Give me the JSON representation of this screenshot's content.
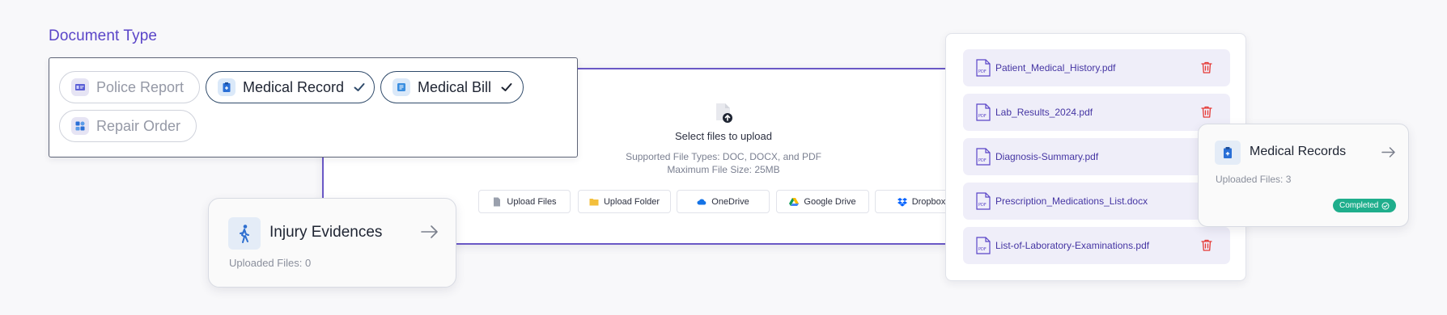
{
  "section_title": "Document Type",
  "document_types": [
    {
      "label": "Police Report",
      "selected": false,
      "icon": "id-card-icon"
    },
    {
      "label": "Medical Record",
      "selected": true,
      "icon": "clipboard-icon"
    },
    {
      "label": "Medical Bill",
      "selected": true,
      "icon": "receipt-icon"
    },
    {
      "label": "Repair Order",
      "selected": false,
      "icon": "tools-icon"
    }
  ],
  "upload": {
    "title": "Select files to upload",
    "supported": "Supported File Types: DOC, DOCX, and PDF",
    "max_size": "Maximum File Size: 25MB",
    "sources": [
      {
        "label": "Upload Files",
        "icon": "file-icon"
      },
      {
        "label": "Upload Folder",
        "icon": "folder-icon"
      },
      {
        "label": "OneDrive",
        "icon": "onedrive-icon"
      },
      {
        "label": "Google Drive",
        "icon": "google-drive-icon"
      },
      {
        "label": "Dropbox",
        "icon": "dropbox-icon"
      }
    ]
  },
  "injury_card": {
    "title": "Injury Evidences",
    "uploaded": "Uploaded Files: 0",
    "icon": "walking-person-icon"
  },
  "files": [
    {
      "name": "Patient_Medical_History.pdf"
    },
    {
      "name": "Lab_Results_2024.pdf"
    },
    {
      "name": "Diagnosis-Summary.pdf"
    },
    {
      "name": "Prescription_Medications_List.docx"
    },
    {
      "name": "List-of-Laboratory-Examinations.pdf"
    }
  ],
  "medical_records_card": {
    "title": "Medical Records",
    "uploaded": "Uploaded Files: 3",
    "status": "Completed"
  },
  "colors": {
    "accent": "#5a45c8",
    "selected_border": "#2f4a6a",
    "file_row_bg": "#efeef9",
    "trash": "#e53935",
    "completed": "#1fae8c"
  }
}
